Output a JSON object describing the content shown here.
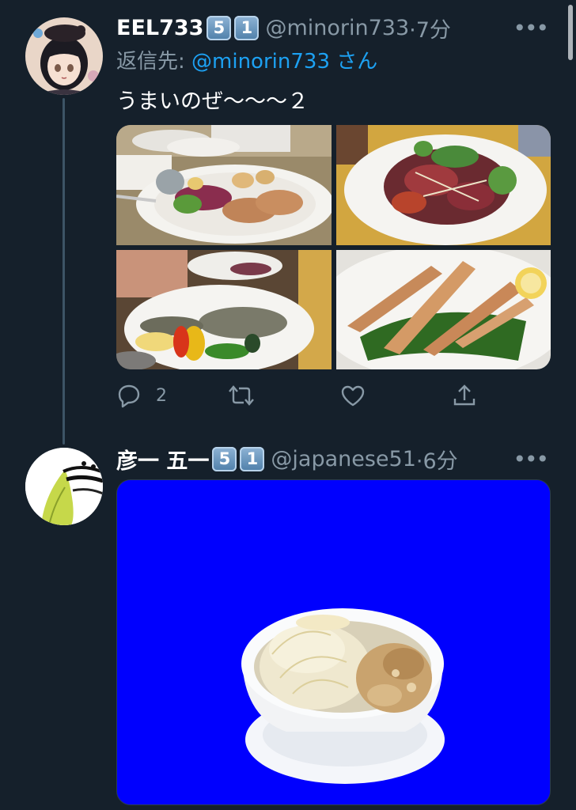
{
  "tweets": [
    {
      "name": "EEL733",
      "badges": [
        "5",
        "1"
      ],
      "handle": "@minorin733",
      "time": "·7分",
      "reply_prefix": "返信先: ",
      "reply_mention": "@minorin733",
      "reply_suffix": " さん",
      "text": "うまいのぜ〜〜〜２",
      "actions": {
        "reply_count": "2",
        "icons": [
          "reply-icon",
          "retweet-icon",
          "like-icon",
          "share-icon"
        ]
      },
      "media_count": 4
    },
    {
      "name": "彦一 五一",
      "badges": [
        "5",
        "1"
      ],
      "handle": "@japanese51",
      "time": "·6分",
      "media_count": 1,
      "media_background": "#0000fe"
    }
  ],
  "colors": {
    "background": "#15202b",
    "secondary_text": "#8899a6",
    "link": "#1da1f2",
    "thread_line": "#3d5466"
  }
}
